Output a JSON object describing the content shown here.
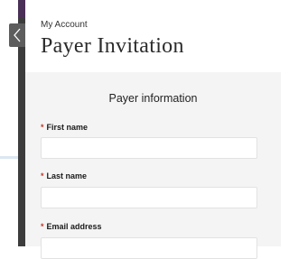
{
  "header": {
    "breadcrumb": "My Account",
    "title": "Payer Invitation"
  },
  "section": {
    "title": "Payer information"
  },
  "form": {
    "required_marker": "*",
    "fields": [
      {
        "label": "First name",
        "value": ""
      },
      {
        "label": "Last name",
        "value": ""
      },
      {
        "label": "Email address",
        "value": ""
      }
    ]
  },
  "colors": {
    "required": "#c0392b",
    "content_bg": "#f4f4f4",
    "stripe": "#3c3c3c"
  },
  "icons": {
    "close": "chevron-left-icon"
  }
}
